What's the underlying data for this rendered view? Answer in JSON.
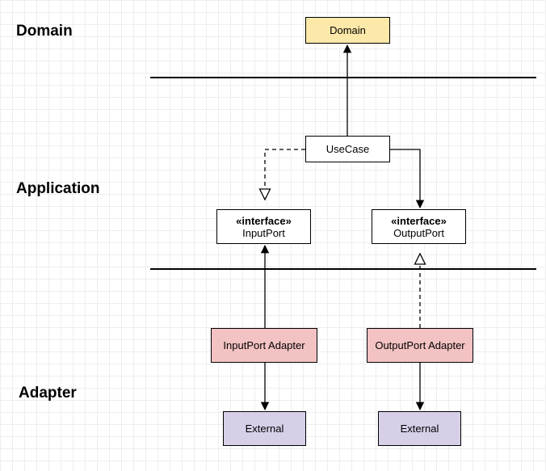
{
  "layers": {
    "domain": "Domain",
    "application": "Application",
    "adapter": "Adapter"
  },
  "boxes": {
    "domain": "Domain",
    "usecase": "UseCase",
    "inputport_stereo": "«interface»",
    "inputport_name": "InputPort",
    "outputport_stereo": "«interface»",
    "outputport_name": "OutputPort",
    "inputadapter": "InputPort Adapter",
    "outputadapter": "OutputPort Adapter",
    "external_left": "External",
    "external_right": "External"
  },
  "colors": {
    "domain_box": "#fce8a8",
    "adapter_box": "#f3c2c2",
    "external_box": "#d7cfe8"
  }
}
